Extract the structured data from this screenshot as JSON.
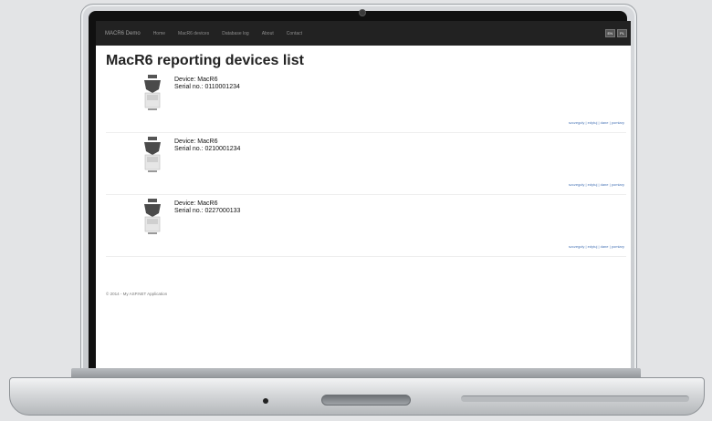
{
  "navbar": {
    "brand": "MACR6 Demo",
    "links": [
      "Home",
      "MacR6 devices",
      "Database log",
      "About",
      "Contact"
    ],
    "lang_buttons": [
      "EN",
      "PL"
    ]
  },
  "page": {
    "title": "MacR6 reporting devices list"
  },
  "devices": [
    {
      "device_label": "Device: MacR6",
      "serial_label": "Serial no.: 0110001234",
      "actions": "szczegoly | edytuj | dane | pomiary"
    },
    {
      "device_label": "Device: MacR6",
      "serial_label": "Serial no.: 0210001234",
      "actions": "szczegoly | edytuj | dane | pomiary"
    },
    {
      "device_label": "Device: MacR6",
      "serial_label": "Serial no.: 0227000133",
      "actions": "szczegoly | edytuj | dane | pomiary"
    }
  ],
  "footer": {
    "text": "© 2014 - My ASP.NET Application"
  }
}
